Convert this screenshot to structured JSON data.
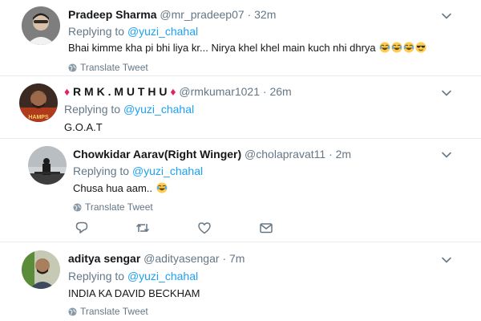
{
  "tweets": [
    {
      "name": "Pradeep Sharma",
      "handle": "@mr_pradeep07",
      "dot": "·",
      "time": "32m",
      "replying_prefix": "Replying to ",
      "replying_to": "@yuzi_chahal",
      "text": "Bhai kimme kha pi bhi liya kr... Nirya khel khel main kuch nhi dhrya",
      "emojis": [
        "joy-emoji",
        "joy-emoji",
        "joy-emoji",
        "sunglasses-emoji"
      ],
      "translate": "Translate Tweet"
    },
    {
      "name": "R M K . M U T H U",
      "name_prefix_icon": "red-diamond",
      "name_suffix_icon": "red-diamond",
      "handle": "@rmkumar1021",
      "dot": "·",
      "time": "26m",
      "replying_prefix": "Replying to ",
      "replying_to": "@yuzi_chahal",
      "text": "G.O.A.T"
    },
    {
      "name": "Chowkidar Aarav(Right Winger)",
      "handle": "@cholapravat11",
      "dot": "·",
      "time": "2m",
      "replying_prefix": "Replying to ",
      "replying_to": "@yuzi_chahal",
      "text": "Chusa hua aam..",
      "emojis": [
        "joy-emoji"
      ],
      "translate": "Translate Tweet",
      "actions": [
        "reply-icon",
        "retweet-icon",
        "like-icon",
        "message-icon"
      ]
    },
    {
      "name": "aditya sengar",
      "handle": "@adityasengar",
      "dot": "·",
      "time": "7m",
      "replying_prefix": "Replying to ",
      "replying_to": "@yuzi_chahal",
      "text": "INDIA KA DAVID BECKHAM",
      "translate": "Translate Tweet"
    }
  ],
  "colors": {
    "link": "#1da1f2",
    "muted": "#657786",
    "text": "#14171a",
    "separator": "#e6ecf0"
  }
}
